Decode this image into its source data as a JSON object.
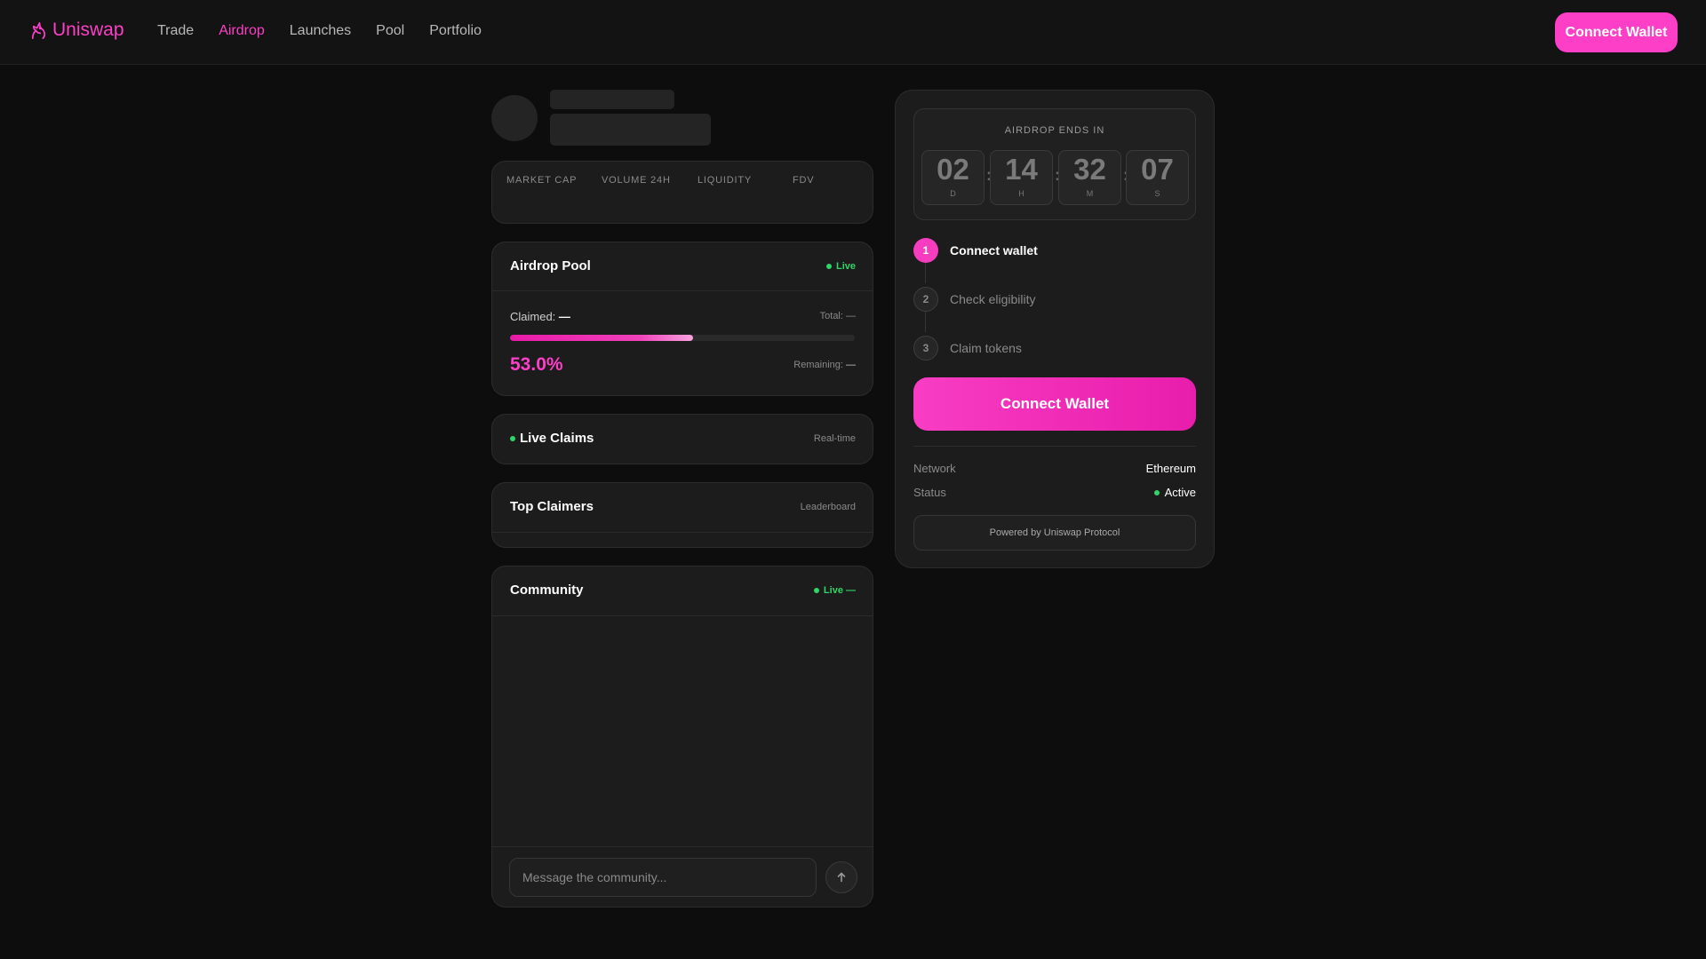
{
  "nav": {
    "logo_text": "Uniswap",
    "links": [
      "Trade",
      "Airdrop",
      "Launches",
      "Pool",
      "Portfolio"
    ],
    "active_link": "Airdrop",
    "connect_label": "Connect Wallet"
  },
  "stats": {
    "labels": [
      "MARKET CAP",
      "VOLUME 24H",
      "LIQUIDITY",
      "FDV"
    ]
  },
  "pool": {
    "title": "Airdrop Pool",
    "status": "Live",
    "claimed_label": "Claimed:",
    "claimed_value": "—",
    "total_label": "Total: —",
    "progress_percent": 53.0,
    "percent_text": "53.0%",
    "remaining_label": "Remaining:",
    "remaining_value": "—"
  },
  "claims": {
    "title": "Live Claims",
    "right": "Real-time"
  },
  "claimers": {
    "title": "Top Claimers",
    "right": "Leaderboard"
  },
  "community": {
    "title": "Community",
    "status": "Live —",
    "placeholder": "Message the community..."
  },
  "countdown": {
    "title": "AIRDROP ENDS IN",
    "units": [
      {
        "value": "02",
        "label": "D"
      },
      {
        "value": "14",
        "label": "H"
      },
      {
        "value": "32",
        "label": "M"
      },
      {
        "value": "07",
        "label": "S"
      }
    ]
  },
  "steps": [
    {
      "num": "1",
      "label": "Connect wallet",
      "active": true
    },
    {
      "num": "2",
      "label": "Check eligibility",
      "active": false
    },
    {
      "num": "3",
      "label": "Claim tokens",
      "active": false
    }
  ],
  "panel": {
    "connect_label": "Connect Wallet",
    "network_label": "Network",
    "network_value": "Ethereum",
    "status_label": "Status",
    "status_value": "Active",
    "powered_text": "Powered by Uniswap Protocol"
  },
  "colors": {
    "accent": "#fc3fc6",
    "live_green": "#2fd566",
    "background": "#0d0d0d",
    "card": "#1c1c1c"
  },
  "icons": [
    "unicorn-logo-icon",
    "send-arrow-icon",
    "live-dot-icon"
  ]
}
